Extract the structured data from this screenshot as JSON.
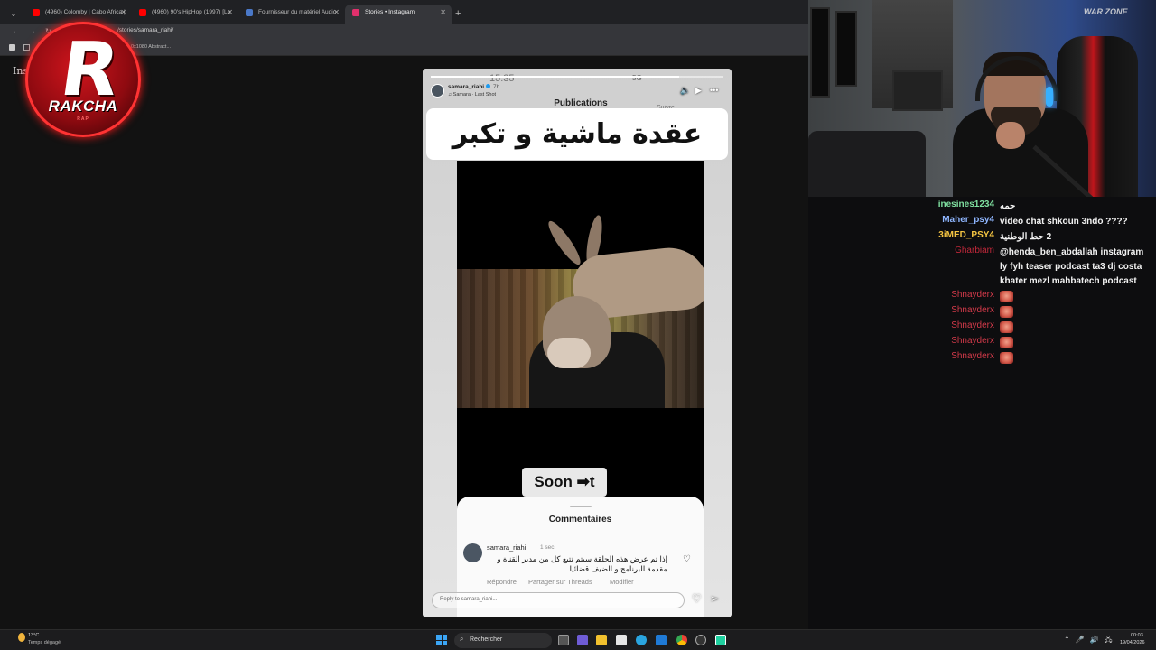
{
  "browser": {
    "tabs": [
      {
        "label": "(4960) Colomby | Cabo Africa |",
        "favicon_color": "#ff0000"
      },
      {
        "label": "(4960) 90's HipHop (1997) [Lo",
        "favicon_color": "#ff0000"
      },
      {
        "label": "Fournisseur du matériel Audio",
        "favicon_color": "#4a78c8"
      },
      {
        "label": "Stories • Instagram",
        "favicon_color": "#e1306c"
      }
    ],
    "new_tab": "+",
    "url": "/stories/samara_riahi/",
    "bookmark": "0x1080 Abstract...",
    "ig_logo_partial": "Ins"
  },
  "overlay": {
    "logo_letter": "R",
    "logo_name": "RAKCHA",
    "logo_sub": "RAP"
  },
  "story": {
    "username": "samara_riahi",
    "time": "7h",
    "music": "Samara · Last Shot",
    "ghost_time": "15:35",
    "ghost_signal": "5G",
    "publications": "Publications",
    "suivre": "Suivre",
    "progress": 0.85,
    "caption": "عقدة ماشية و تكبر بيك ..",
    "soon_text": "Soon",
    "soon_suffix": "t",
    "comments_title": "Commentaires",
    "comment": {
      "user": "samara_riahi",
      "time": "1 sec",
      "text": "إذا تم عرض هذه الحلقة سيتم تتبع كل من مدير القناة و مقدمة البرنامج و الضيف قضائيا",
      "actions": [
        "Répondre",
        "Partager sur Threads",
        "Modifier"
      ]
    },
    "reply_placeholder": "Reply to samara_riahi..."
  },
  "chat": [
    {
      "user": "inesines1234",
      "color": "#7fe0a0",
      "msg": "حمه"
    },
    {
      "user": "Maher_psy4",
      "color": "#8fb6ff",
      "msg": "video chat shkoun 3ndo ????"
    },
    {
      "user": "3iMED_PSY4",
      "color": "#f5c542",
      "msg": "2 حط الوطنية"
    },
    {
      "user": "Gharbiam",
      "color": "#c2283a",
      "msg": "@henda_ben_abdallah instagram ly fyh teaser podcast ta3 dj costa khater mezl mahbatech podcast"
    },
    {
      "user": "Shnayderx",
      "color": "#d43a4a",
      "msg": ""
    },
    {
      "user": "Shnayderx",
      "color": "#d43a4a",
      "msg": ""
    },
    {
      "user": "Shnayderx",
      "color": "#d43a4a",
      "msg": ""
    },
    {
      "user": "Shnayderx",
      "color": "#d43a4a",
      "msg": ""
    },
    {
      "user": "Shnayderx",
      "color": "#d43a4a",
      "msg": ""
    }
  ],
  "webcam": {
    "poster_text": "WAR ZONE"
  },
  "taskbar": {
    "weather_temp": "13°C",
    "weather_desc": "Temps dégagé",
    "search": "Rechercher",
    "time": "00:03",
    "date": "19/04/2026"
  }
}
